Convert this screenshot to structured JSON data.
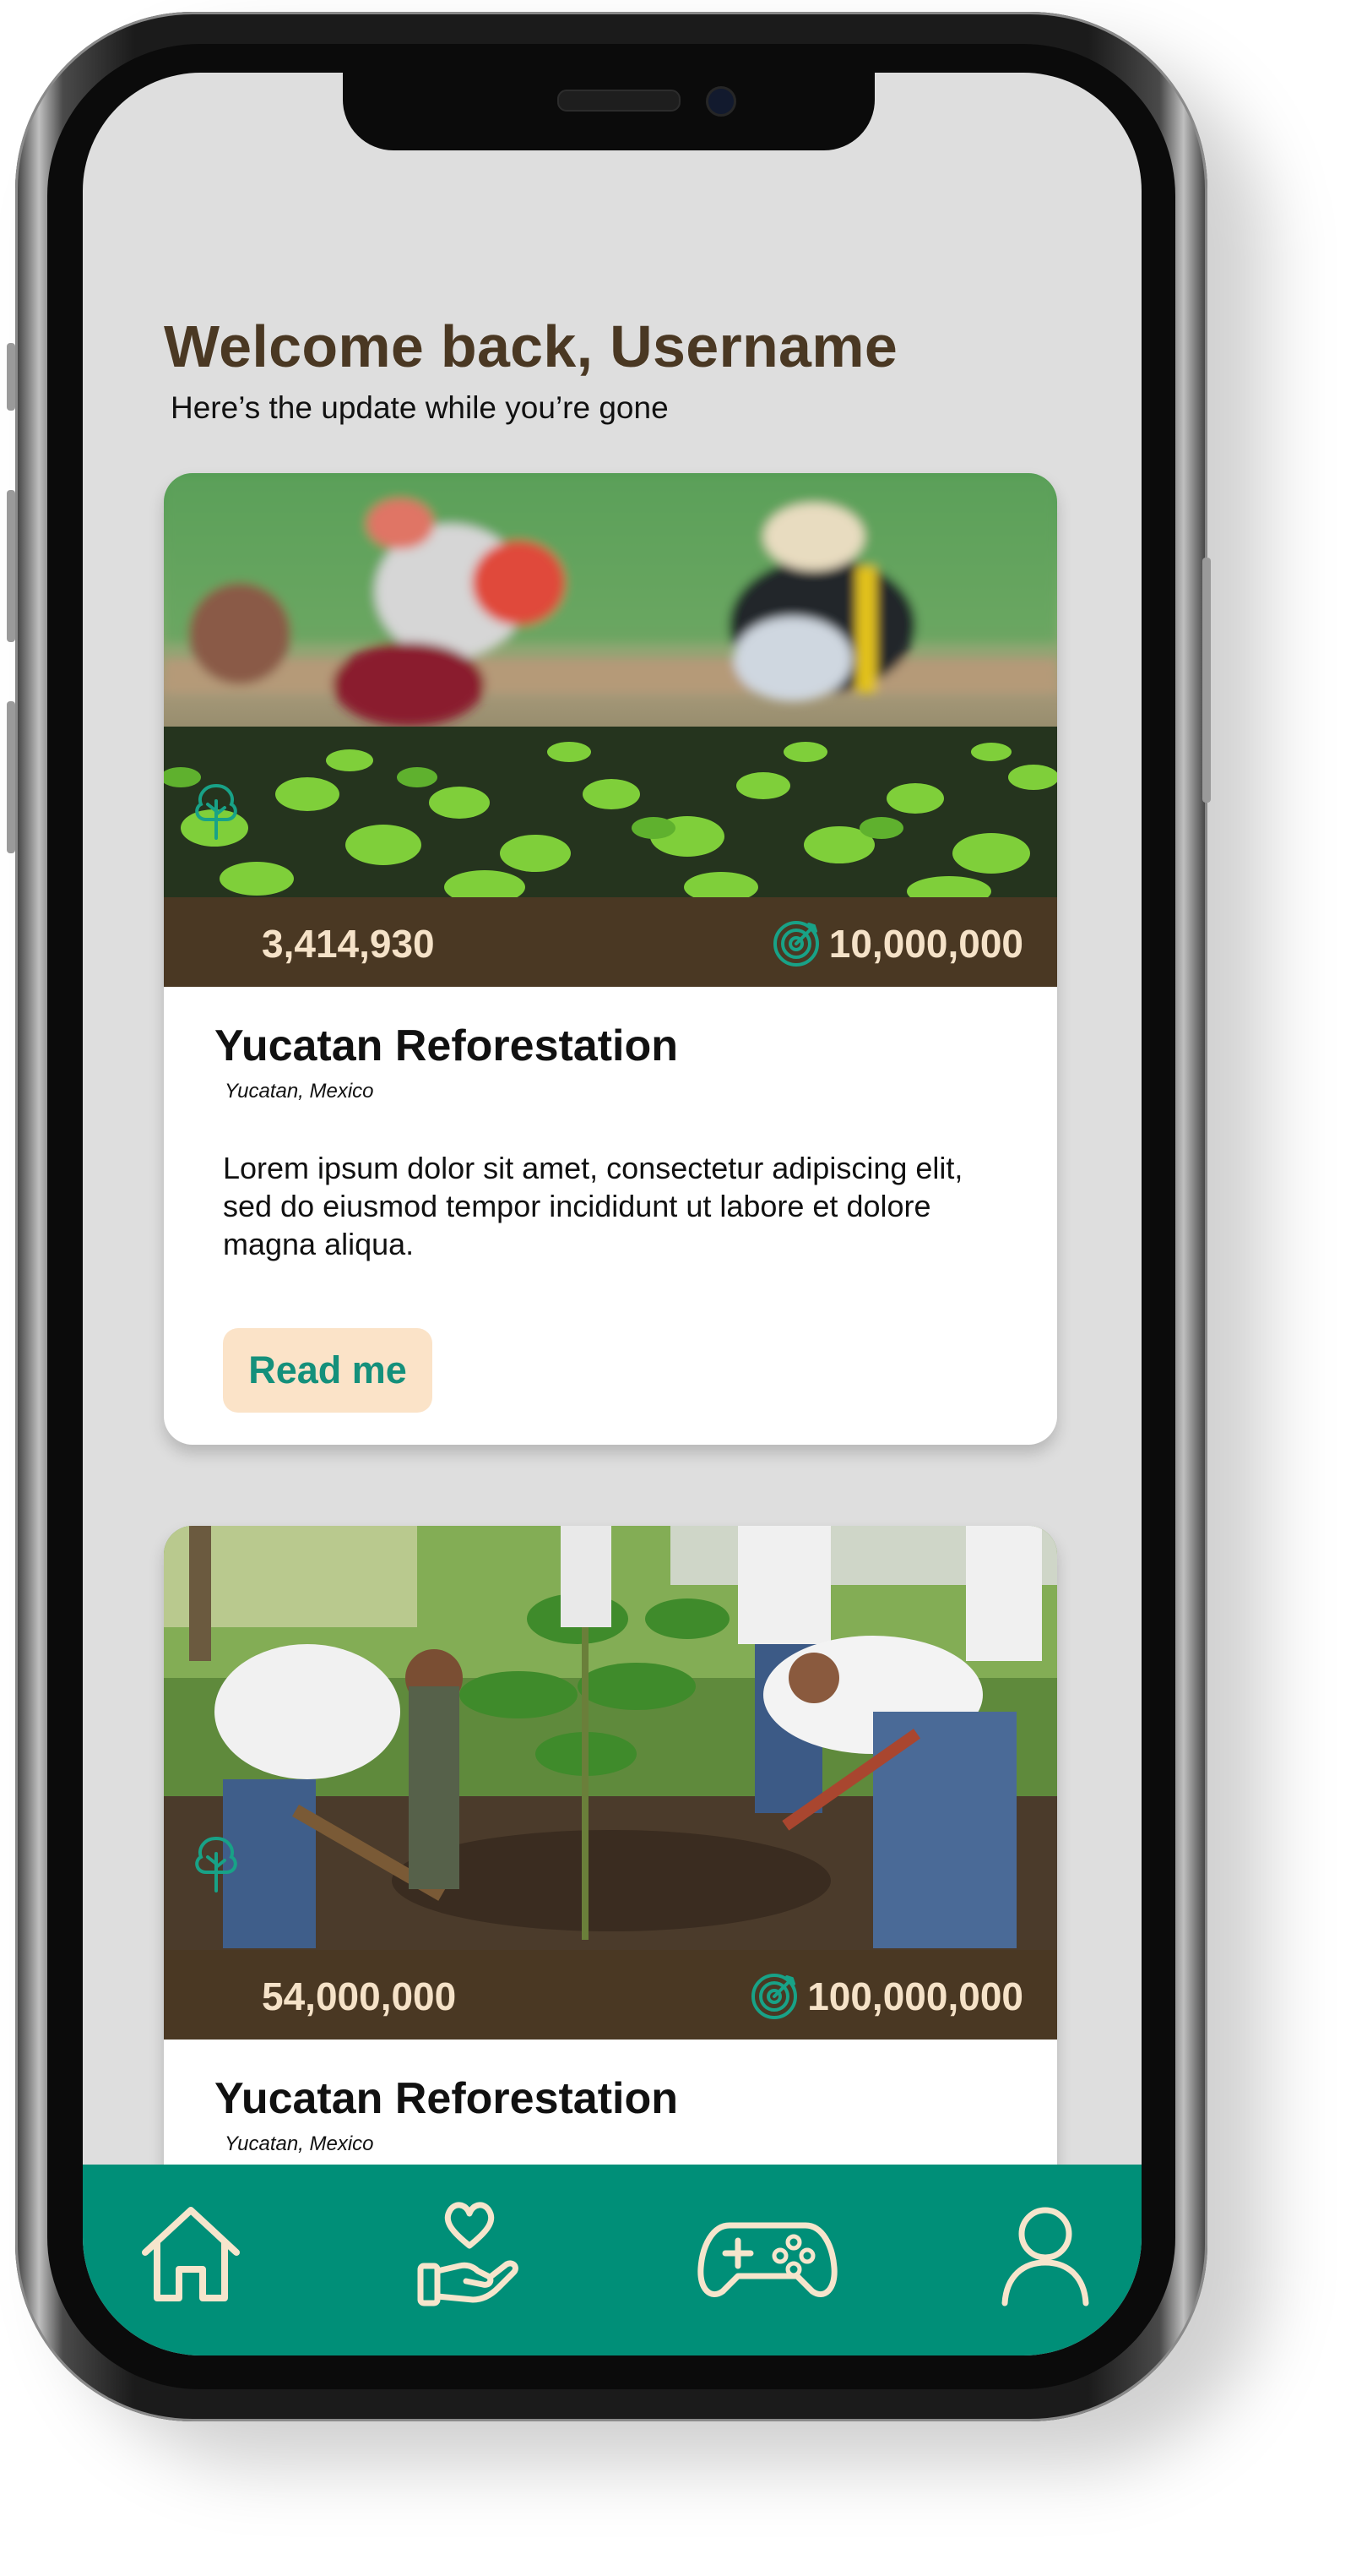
{
  "greeting": {
    "title": "Welcome back, Username",
    "subtitle": "Here’s the update while you’re gone"
  },
  "projects": [
    {
      "image": "seedling-nursery-photo",
      "trees_planted": "3,414,930",
      "goal": "10,000,000",
      "title": "Yucatan Reforestation",
      "location": "Yucatan, Mexico",
      "description": "Lorem ipsum dolor sit amet, consectetur adipiscing elit, sed do eiusmod tempor incididunt ut labore et dolore magna aliqua.",
      "button_label": "Read me"
    },
    {
      "image": "volunteers-planting-photo",
      "trees_planted": "54,000,000",
      "goal": "100,000,000",
      "title": "Yucatan Reforestation",
      "location": "Yucatan, Mexico"
    }
  ],
  "nav": {
    "items": [
      {
        "icon": "home-icon"
      },
      {
        "icon": "donate-heart-hand-icon"
      },
      {
        "icon": "gamepad-icon"
      },
      {
        "icon": "profile-icon"
      }
    ]
  },
  "colors": {
    "accent": "#008f78",
    "brown": "#4a3823",
    "button_bg": "#fbe3c8",
    "screen_bg": "#dedede"
  }
}
